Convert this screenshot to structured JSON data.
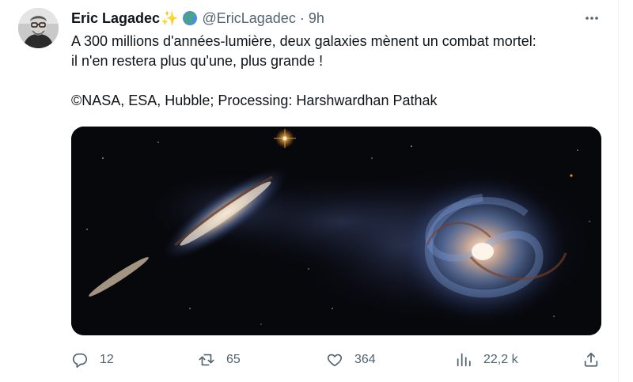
{
  "tweet": {
    "author": {
      "name": "Eric Lagadec",
      "name_emoji": "✨",
      "globe_icon": "globe-icon",
      "handle": "@EricLagadec",
      "separator": "·",
      "time": "9h"
    },
    "text_line1": "A 300 millions d'années-lumière, deux galaxies mènent un combat mortel:",
    "text_line2": "il n'en restera plus qu'une, plus grande !",
    "credit": "©NASA, ESA, Hubble; Processing: Harshwardhan Pathak",
    "media_icon": "galaxy-photo",
    "actions": {
      "replies": "12",
      "retweets": "65",
      "likes": "364",
      "views": "22,2 k"
    }
  },
  "colors": {
    "text": "#0f1419",
    "muted": "#536471",
    "media_bg": "#07080c"
  }
}
